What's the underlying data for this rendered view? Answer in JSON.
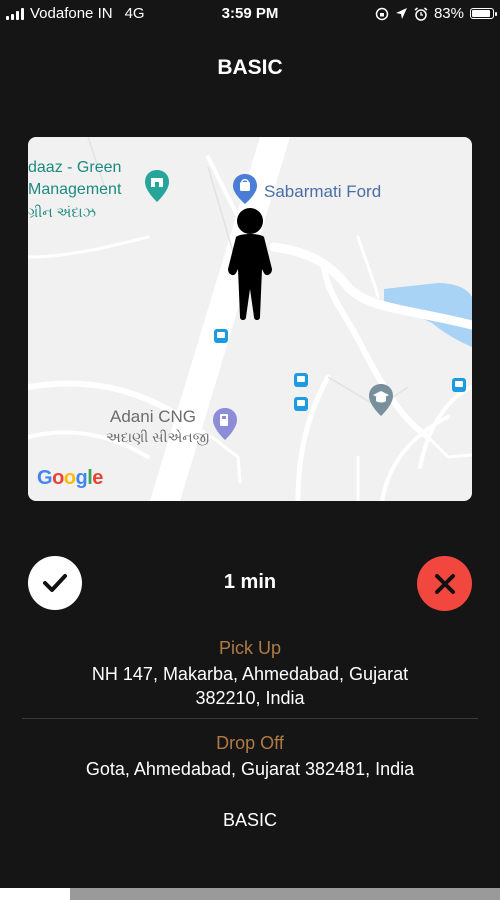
{
  "status_bar": {
    "carrier": "Vodafone IN",
    "network": "4G",
    "time": "3:59 PM",
    "battery": "83%"
  },
  "title": "BASIC",
  "map": {
    "places": {
      "green_management_line1": "daaz - Green",
      "green_management_line2": "Management",
      "green_management_local": "ગ્રીન અંદાઝ",
      "sabarmati_ford": "Sabarmati Ford",
      "adani_cng": "Adani CNG",
      "adani_cng_local": "અદાણી સીએનજી"
    },
    "logo": "Google"
  },
  "ride_request": {
    "eta": "1 min",
    "pickup_label": "Pick Up",
    "pickup_address_line1": "NH 147, Makarba, Ahmedabad, Gujarat",
    "pickup_address_line2": "382210, India",
    "dropoff_label": "Drop Off",
    "dropoff_address": "Gota, Ahmedabad, Gujarat 382481, India",
    "category": "BASIC"
  },
  "timer_progress": 0.14,
  "colors": {
    "background": "#151515",
    "accent_label": "#b07a45",
    "reject": "#f2473f",
    "accept": "#ffffff"
  },
  "icons": {
    "accept": "check-icon",
    "reject": "close-icon",
    "driver": "person-marker-icon"
  }
}
